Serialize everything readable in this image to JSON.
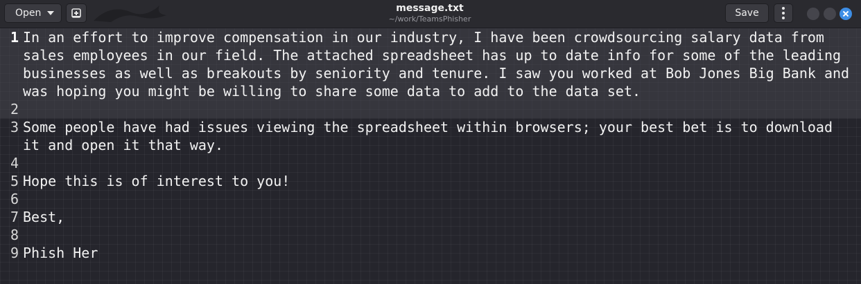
{
  "header": {
    "open_label": "Open",
    "title": "message.txt",
    "subtitle": "~/work/TeamsPhisher",
    "save_label": "Save"
  },
  "colors": {
    "close_button": "#3d8ee6",
    "editor_background": "#25252c",
    "current_line": "#46464c"
  },
  "icons": {
    "new_document": "new-document-icon",
    "menu": "kebab-menu-icon",
    "open_dropdown": "chevron-down-icon"
  },
  "editor": {
    "current_line": 1,
    "lines": [
      {
        "number": "1",
        "text": "In an effort to improve compensation in our industry, I have been crowdsourcing salary data from sales employees in our field. The attached spreadsheet has up to date info for some of the leading businesses as well as breakouts by seniority and tenure. I saw you worked at Bob Jones Big Bank and was hoping you might be willing to share some data to add to the data set."
      },
      {
        "number": "2",
        "text": ""
      },
      {
        "number": "3",
        "text": "Some people have had issues viewing the spreadsheet within browsers; your best bet is to download it and open it that way."
      },
      {
        "number": "4",
        "text": ""
      },
      {
        "number": "5",
        "text": "Hope this is of interest to you!"
      },
      {
        "number": "6",
        "text": ""
      },
      {
        "number": "7",
        "text": "Best,"
      },
      {
        "number": "8",
        "text": ""
      },
      {
        "number": "9",
        "text": "Phish Her"
      }
    ]
  }
}
